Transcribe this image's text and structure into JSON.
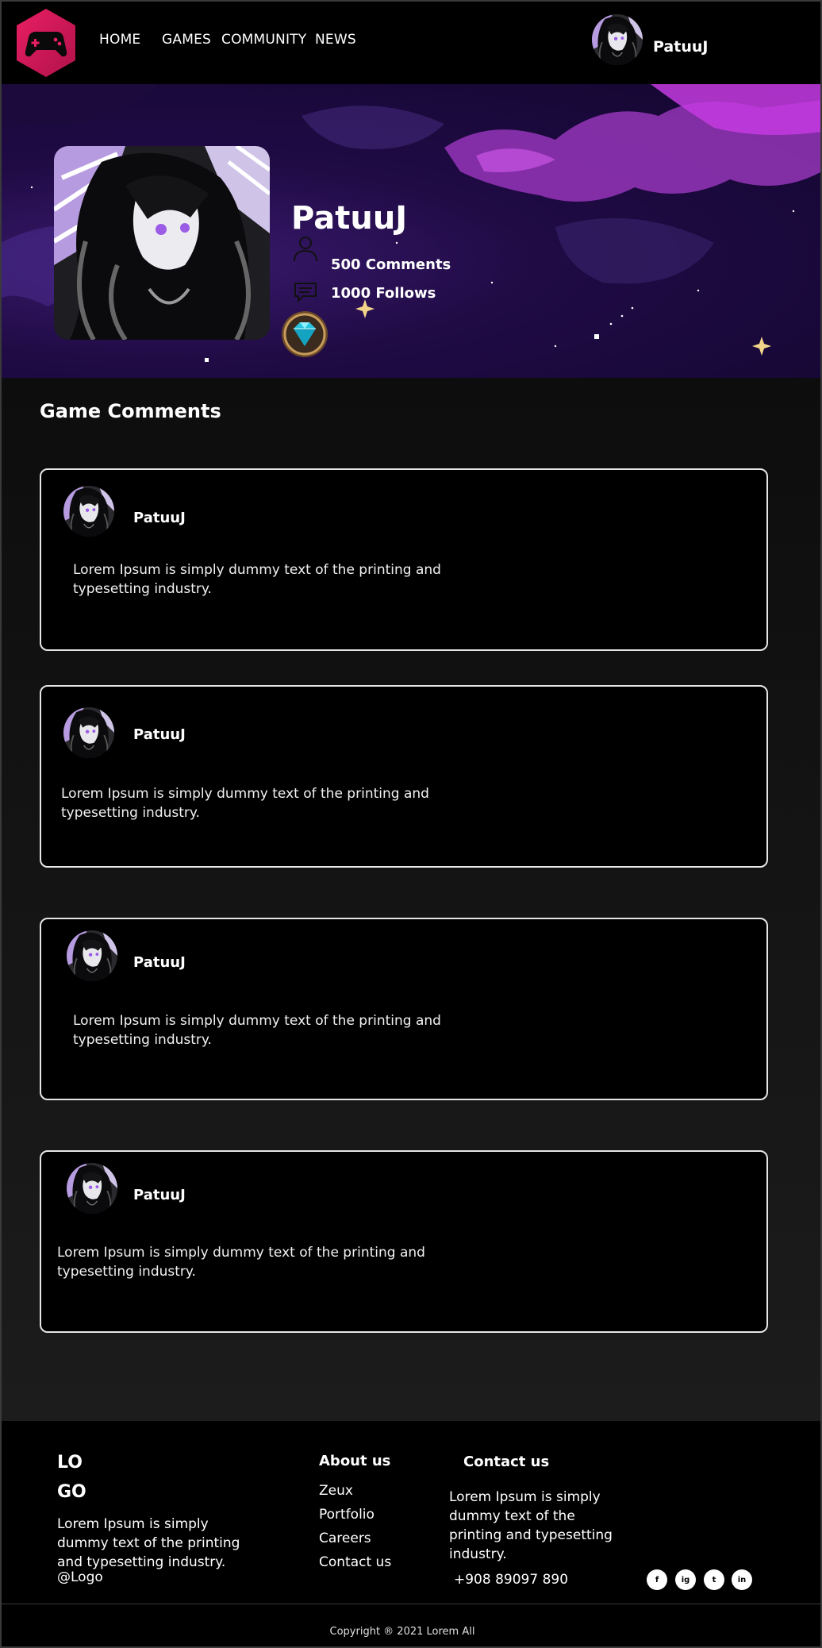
{
  "header": {
    "nav": [
      "HOME",
      "GAMES",
      "COMMUNITY",
      "NEWS"
    ],
    "username": "PatuuJ"
  },
  "profile": {
    "name": "PatuuJ",
    "comments": "500 Comments",
    "follows": "1000 Follows"
  },
  "comments_section": {
    "title": "Game Comments",
    "items": [
      {
        "user": "PatuuJ",
        "text": "Lorem Ipsum is simply dummy text of the printing and typesetting industry."
      },
      {
        "user": "PatuuJ",
        "text": "Lorem Ipsum is simply dummy text of the printing and typesetting industry."
      },
      {
        "user": "PatuuJ",
        "text": "Lorem Ipsum is simply dummy text of the printing and typesetting industry."
      },
      {
        "user": "PatuuJ",
        "text": "Lorem Ipsum is simply dummy text of the printing and typesetting industry."
      }
    ]
  },
  "footer": {
    "logo_line1": "LO",
    "logo_line2": "GO",
    "description": "Lorem Ipsum is simply dummy text of the printing and typesetting industry.",
    "handle": "@Logo",
    "about_title": "About us",
    "about_links": [
      "Zeux",
      "Portfolio",
      "Careers",
      "Contact us"
    ],
    "contact_title": "Contact us",
    "contact_text": "Lorem Ipsum is simply dummy text of the printing and typesetting industry.",
    "phone": "+908 89097 890",
    "social": [
      "f",
      "ig",
      "t",
      "in"
    ],
    "copyright": "Copyright ® 2021 Lorem All"
  },
  "colors": {
    "accent": "#d81b60",
    "banner_purple": "#c43be0"
  },
  "icons": [
    "gamepad-icon",
    "user-icon",
    "comment-icon",
    "diamond-rank-icon",
    "facebook-icon",
    "instagram-icon",
    "twitter-icon",
    "linkedin-icon"
  ]
}
